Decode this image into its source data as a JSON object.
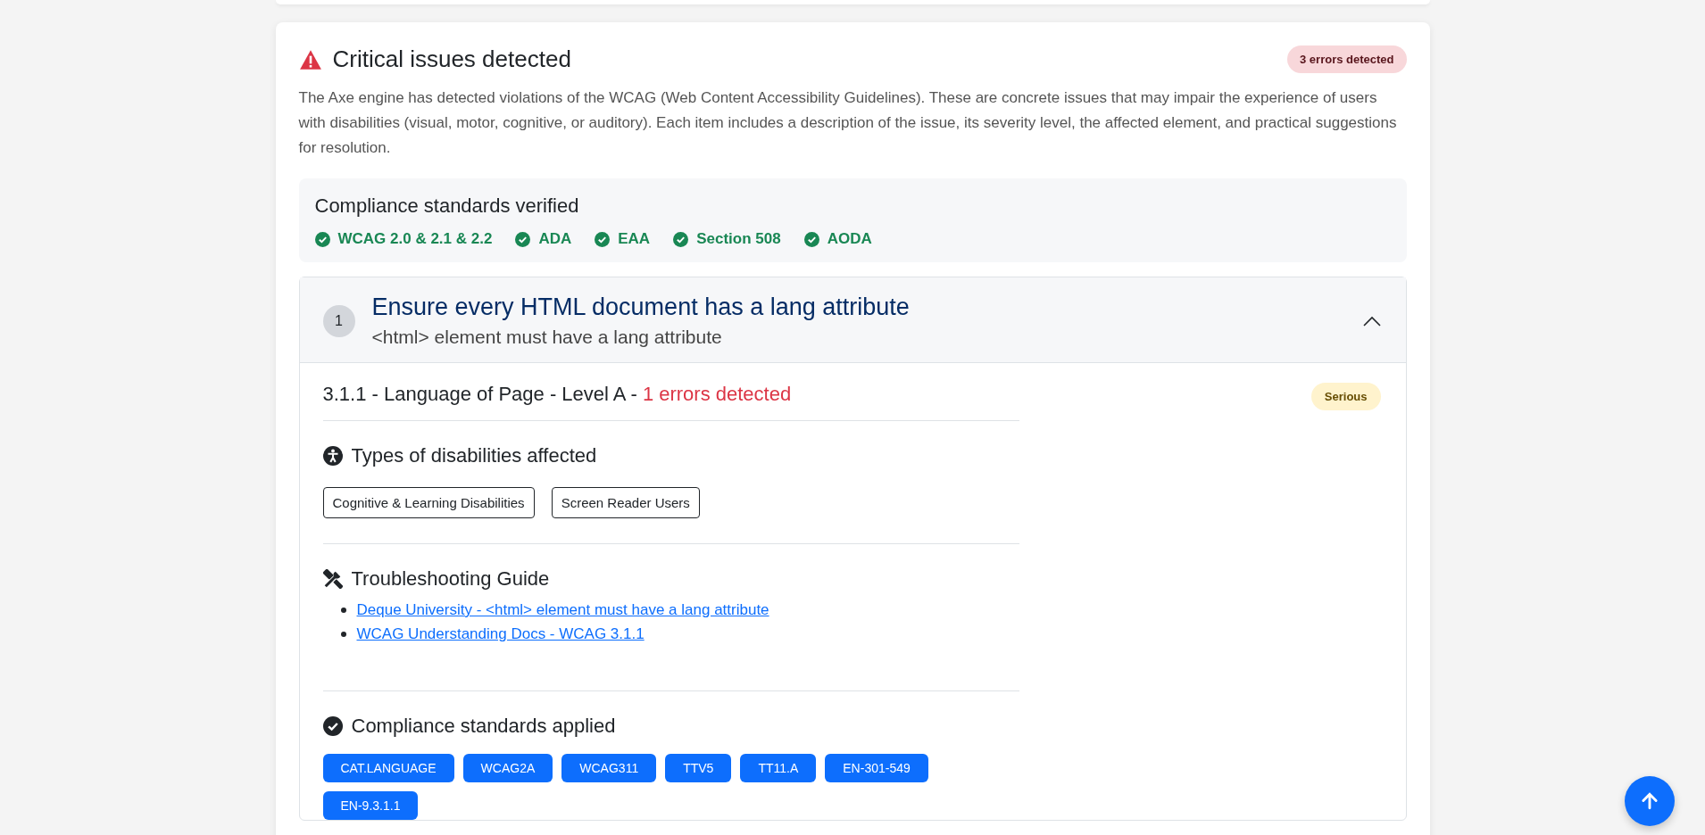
{
  "summary": {
    "title": "Critical issues detected",
    "count_badge": "3 errors detected",
    "description": "The Axe engine has detected violations of the WCAG (Web Content Accessibility Guidelines). These are concrete issues that may impair the experience of users with disabilities (visual, motor, cognitive, or auditory). Each item includes a description of the issue, its severity level, the affected element, and practical suggestions for resolution."
  },
  "standards_verified": {
    "title": "Compliance standards verified",
    "items": [
      "WCAG 2.0 & 2.1 & 2.2",
      "ADA",
      "EAA",
      "Section 508",
      "AODA"
    ]
  },
  "issues": [
    {
      "number": "1",
      "title": "Ensure every HTML document has a lang attribute",
      "subtitle": "<html> element must have a lang attribute",
      "expanded": true,
      "criterion": "3.1.1 - Language of Page - Level A - ",
      "errors": "1 errors detected",
      "severity": "Serious",
      "disabilities_title": "Types of disabilities affected",
      "disabilities": [
        "Cognitive & Learning Disabilities",
        "Screen Reader Users"
      ],
      "guide_title": "Troubleshooting Guide",
      "links": [
        "Deque University - <html> element must have a lang attribute",
        "WCAG Understanding Docs - WCAG 3.1.1"
      ],
      "standards_title": "Compliance standards applied",
      "tags": [
        "CAT.LANGUAGE",
        "WCAG2A",
        "WCAG311",
        "TTV5",
        "TT11.A",
        "EN-301-549",
        "EN-9.3.1.1"
      ]
    }
  ]
}
